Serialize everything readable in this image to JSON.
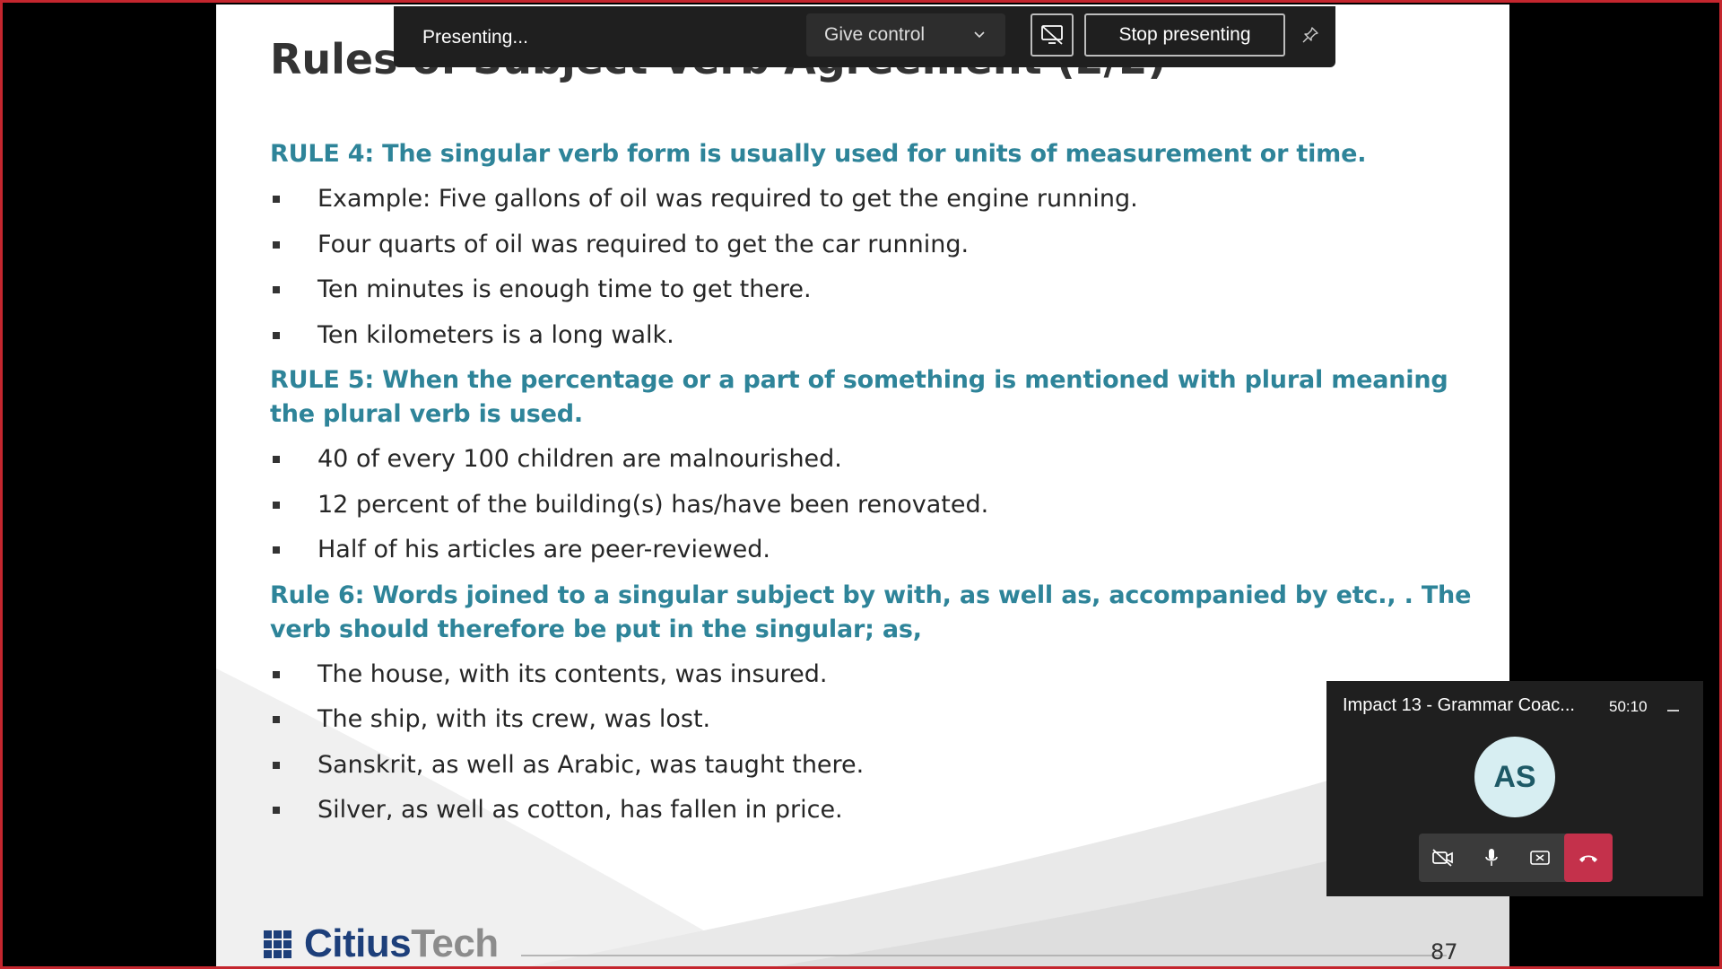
{
  "slide": {
    "title": "Rules of Subject Verb Agreement (2/2)",
    "sections": [
      {
        "heading": "RULE 4: The singular verb form is usually used for units of measurement or time.",
        "bullets": [
          "Example: Five gallons of oil was required to get the engine running.",
          "Four quarts of oil was required to get the car running.",
          "Ten minutes is enough time to get there.",
          "Ten kilometers is a long walk."
        ]
      },
      {
        "heading": "RULE 5: When the percentage or a part of something is mentioned with plural meaning the plural verb is used.",
        "bullets": [
          "40 of every 100 children are malnourished.",
          "12 percent of the building(s) has/have been renovated.",
          "Half of his articles are peer-reviewed."
        ]
      },
      {
        "heading": "Rule 6: Words joined to a singular subject by with, as well as, accompanied by etc., . The verb should therefore be put in the singular; as,",
        "bullets": [
          "The house, with its contents, was insured.",
          "The ship, with its crew, was lost.",
          "Sanskrit, as well as Arabic, was taught there.",
          "Silver, as well as cotton, has fallen in price."
        ]
      }
    ],
    "logo_part1": "Citius",
    "logo_part2": "Tech",
    "page_number": "87"
  },
  "present_bar": {
    "status_label": "Presenting...",
    "give_control_label": "Give control",
    "stop_label": "Stop presenting"
  },
  "mini_window": {
    "meeting_title": "Impact 13 - Grammar Coac...",
    "elapsed": "50:10",
    "avatar_initials": "AS"
  },
  "colors": {
    "frame_border": "#c4262e",
    "rule_heading": "#2e8499",
    "hangup": "#c4314b"
  },
  "icons": [
    "chevron-down-icon",
    "stop-share-screen-icon",
    "pin-icon",
    "minimize-icon",
    "video-off-icon",
    "microphone-icon",
    "share-screen-icon",
    "hang-up-icon"
  ]
}
